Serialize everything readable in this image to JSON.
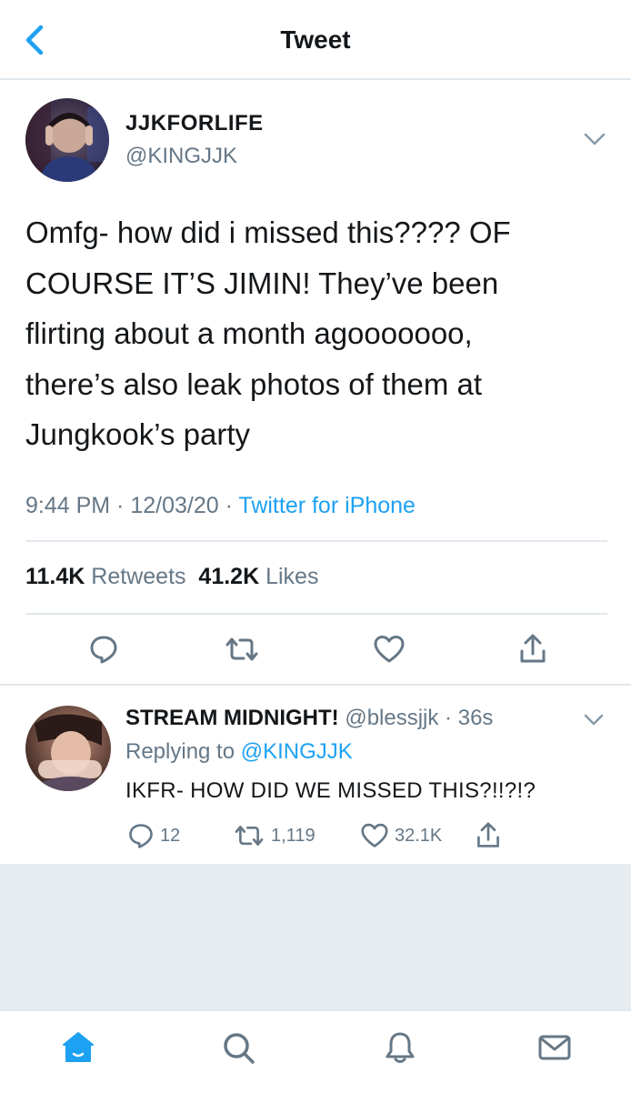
{
  "header": {
    "title": "Tweet"
  },
  "tweet": {
    "author_name": "JJKFORLIFE",
    "author_handle": "@KINGJJK",
    "lines": [
      "Omfg- how did i missed this???? OF",
      "COURSE IT’S JIMIN! They’ve been",
      "flirting about a month agooooooo,",
      "there’s also leak photos of them at",
      "Jungkook’s party"
    ],
    "time": "9:44 PM",
    "sep1": " · ",
    "date": "12/03/20",
    "sep2": " · ",
    "source": "Twitter for iPhone",
    "retweets_count": "11.4K",
    "retweets_label": "Retweets",
    "likes_count": "41.2K",
    "likes_label": "Likes"
  },
  "reply": {
    "name": "STREAM MIDNIGHT!",
    "handle": "@blessjjk",
    "sep": " · ",
    "time": "36s",
    "replying_prefix": "Replying to",
    "replying_to": "@KINGJJK",
    "text": "IKFR- HOW DID WE MISSED THIS?!!?!?",
    "reply_count": "12",
    "retweet_count": "1,119",
    "like_count": "32.1K"
  },
  "colors": {
    "accent": "#1da1f2",
    "secondary_text": "#657786",
    "divider": "#e1e8ed"
  },
  "icons": {
    "back": "chevron-left-icon",
    "more": "chevron-down-icon",
    "reply": "speech-bubble-icon",
    "retweet": "retweet-icon",
    "like": "heart-icon",
    "share": "share-icon",
    "home": "home-icon",
    "search": "search-icon",
    "notifications": "bell-icon",
    "messages": "envelope-icon"
  }
}
